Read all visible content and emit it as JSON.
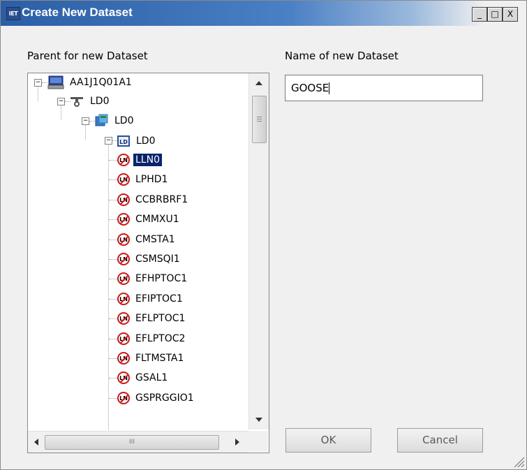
{
  "window": {
    "title": "Create New Dataset",
    "app_icon_text": "IET",
    "minimize": "_",
    "maximize": "□",
    "close": "X"
  },
  "parent_label": "Parent for new Dataset",
  "name_label": "Name of new Dataset",
  "name_value": "GOOSE",
  "tree": {
    "root": "AA1J1Q01A1",
    "level1": "LD0",
    "level2": "LD0",
    "level3": "LD0",
    "ld_icon_text": "LD",
    "ln_icon_text": "LN",
    "items": [
      "LLN0",
      "LPHD1",
      "CCBRBRF1",
      "CMMXU1",
      "CMSTA1",
      "CSMSQI1",
      "EFHPTOC1",
      "EFIPTOC1",
      "EFLPTOC1",
      "EFLPTOC2",
      "FLTMSTA1",
      "GSAL1",
      "GSPRGGIO1"
    ],
    "selected": "LLN0"
  },
  "buttons": {
    "ok": "OK",
    "cancel": "Cancel"
  },
  "scroll": {
    "grip": "III"
  }
}
